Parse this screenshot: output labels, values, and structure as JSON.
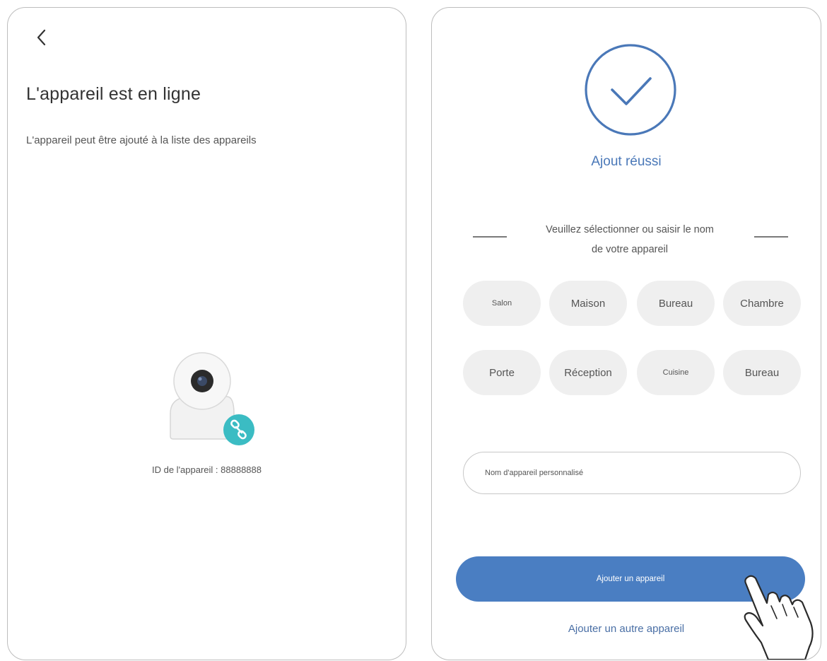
{
  "left_screen": {
    "title": "L'appareil est en ligne",
    "subtitle": "L'appareil peut être ajouté à la liste des appareils",
    "device_id_text": "ID de l'appareil : 88888888",
    "icons": [
      "back-chevron-icon",
      "camera-icon",
      "link-icon"
    ]
  },
  "right_screen": {
    "success_text": "Ajout réussi",
    "prompt_line1": "Veuillez sélectionner ou saisir le nom",
    "prompt_line2": "de votre appareil",
    "name_options": [
      "Salon",
      "Maison",
      "Bureau",
      "Chambre",
      "Porte",
      "Réception",
      "Cuisine",
      "Bureau"
    ],
    "custom_name_placeholder": "Nom d'appareil personnalisé",
    "add_button_label": "Ajouter un appareil",
    "add_another_label": "Ajouter un autre appareil",
    "icons": [
      "check-circle-icon",
      "hand-pointer-icon"
    ]
  },
  "colors": {
    "accent": "#4a7ec2",
    "success_blue": "#4a78b8",
    "teal_badge": "#3bbcc3",
    "chip_bg": "#efefef",
    "panel_border": "#bdbdbd"
  }
}
